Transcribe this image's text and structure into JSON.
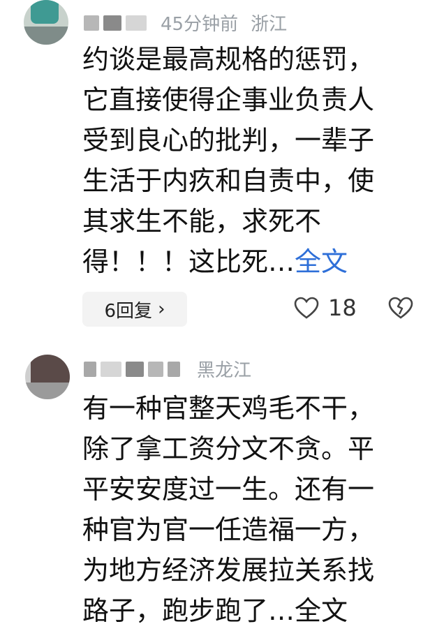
{
  "comments": [
    {
      "time": "45分钟前",
      "location": "浙江",
      "lines": [
        "约谈是最高规格的惩罚，",
        "它直接使得企事业负责人",
        "受到良心的批判，一辈子",
        "生活于内疚和自责中，使",
        "其求生不能，求死不",
        "得！！！这比死…"
      ],
      "more": "全文",
      "replies": "6回复",
      "likes": "18"
    },
    {
      "location": "黑龙江",
      "lines": [
        "有一种官整天鸡毛不干，",
        "除了拿工资分文不贪。平",
        "平安安度过一生。还有一",
        "种官为官一任造福一方，",
        "为地方经济发展拉关系找",
        "路子，跑步跑了…全文"
      ]
    }
  ],
  "icons": {
    "reply_chevron": "chevron-right-icon",
    "like": "heart-icon",
    "dislike": "broken-heart-icon"
  },
  "colors": {
    "link": "#2e6fd8",
    "meta": "#9aa0a6",
    "text": "#111111"
  }
}
